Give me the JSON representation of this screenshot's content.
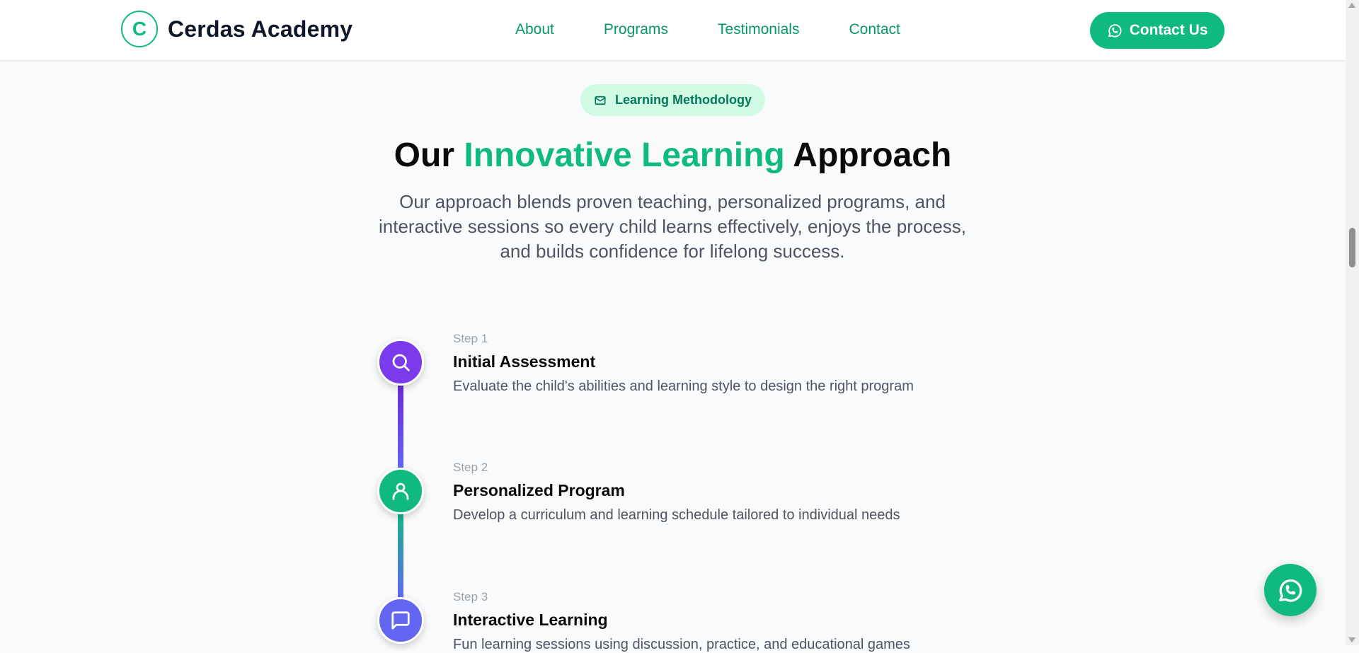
{
  "header": {
    "logo_letter": "C",
    "brand": "Cerdas Academy",
    "nav": [
      "About",
      "Programs",
      "Testimonials",
      "Contact"
    ],
    "cta_label": "Contact Us",
    "cta_icon": "whatsapp-icon"
  },
  "section": {
    "badge_icon": "mail-icon",
    "badge": "Learning Methodology",
    "title_pre": "Our ",
    "title_accent": "Innovative Learning",
    "title_post": " Approach",
    "subtitle": "Our approach blends proven teaching, personalized programs, and interactive sessions so every child learns effectively, enjoys the process, and builds confidence for lifelong success."
  },
  "steps": [
    {
      "num": "Step 1",
      "title": "Initial Assessment",
      "desc": "Evaluate the child's abilities and learning style to design the right program",
      "icon": "search-icon",
      "color": "#7c3aed"
    },
    {
      "num": "Step 2",
      "title": "Personalized Program",
      "desc": "Develop a curriculum and learning schedule tailored to individual needs",
      "icon": "user-icon",
      "color": "#10b981"
    },
    {
      "num": "Step 3",
      "title": "Interactive Learning",
      "desc": "Fun learning sessions using discussion, practice, and educational games",
      "icon": "chat-icon",
      "color": "#6366f1"
    }
  ],
  "colors": {
    "accent": "#10b981",
    "background": "#f8fafc"
  },
  "fab_icon": "whatsapp-icon"
}
